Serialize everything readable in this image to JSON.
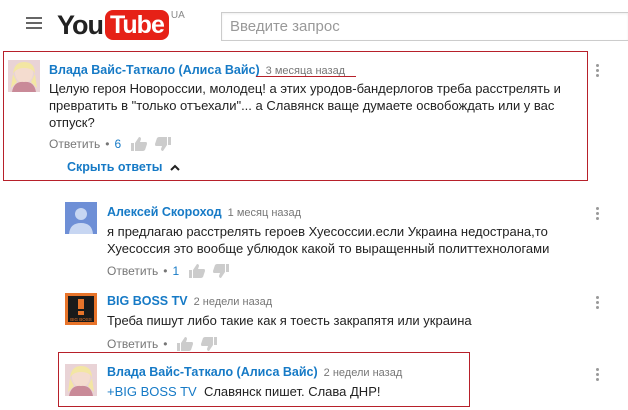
{
  "header": {
    "logo_you": "You",
    "logo_tube": "Tube",
    "region": "UA",
    "search_placeholder": "Введите запрос"
  },
  "comments": [
    {
      "author": "Влада Вайс-Таткало (Алиса Вайс)",
      "time": "3 месяца назад",
      "text": "Целую героя Новороссии, молодец!  а этих уродов-бандерлогов треба расстрелять и превратить в \"только отъехали\"... а Славянск ваще думаете освобождать или у вас отпуск?",
      "reply_label": "Ответить",
      "likes": "6",
      "hide_replies": "Скрыть ответы"
    },
    {
      "author": "Алексей Скороход",
      "time": "1 месяц назад",
      "text": "я предлагаю расстрелять героев Хуесоссии.если Украина недострана,то Хуесоссия это вообще ублюдок какой то выращенный политтехнологами",
      "reply_label": "Ответить",
      "likes": "1"
    },
    {
      "author": "BIG BOSS TV",
      "time": "2 недели назад",
      "text": "Треба пишут либо такие как я тоесть закрапятя или украина",
      "reply_label": "Ответить",
      "avatar_text": "BIG BOSS"
    },
    {
      "author": "Влада Вайс-Таткало (Алиса Вайс)",
      "time": "2 недели назад",
      "mention": "+BIG BOSS TV",
      "text": "Славянск пишет. Слава ДНР!"
    }
  ],
  "colors": {
    "link": "#167ac6",
    "brand_red": "#e62117",
    "highlight": "#b7202a",
    "meta": "#767676"
  },
  "icons": [
    "menu-icon",
    "thumb-up-icon",
    "thumb-down-icon",
    "more-vert-icon",
    "chevron-up-icon"
  ]
}
